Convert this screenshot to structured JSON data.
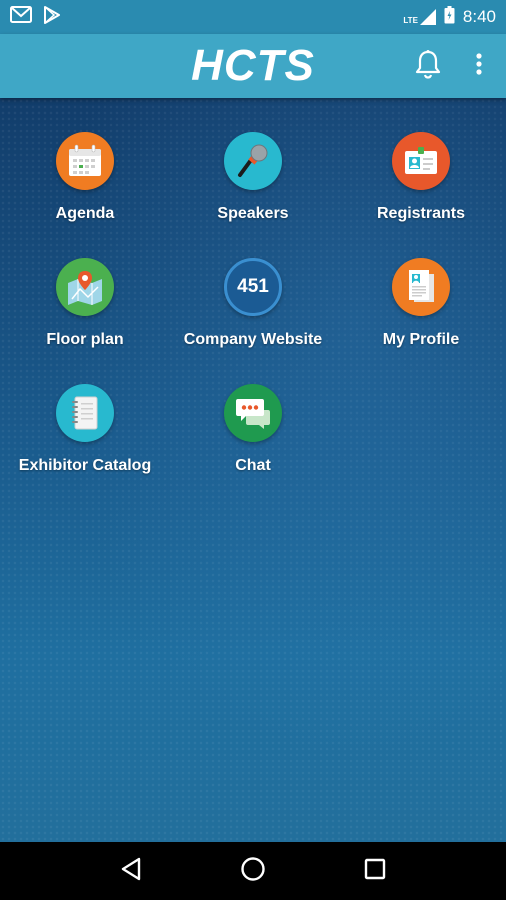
{
  "app": {
    "title": "HCTS"
  },
  "status": {
    "network": "LTE",
    "time": "8:40"
  },
  "tiles": [
    {
      "label": "Agenda",
      "icon": "calendar-icon",
      "color": "#f07c22"
    },
    {
      "label": "Speakers",
      "icon": "microphone-icon",
      "color": "#28b9cf"
    },
    {
      "label": "Registrants",
      "icon": "id-card-icon",
      "color": "#e8582b"
    },
    {
      "label": "Floor plan",
      "icon": "map-pin-icon",
      "color": "#4bb04f"
    },
    {
      "label": "Company Website",
      "icon": "website-icon",
      "badge": "451",
      "color": "#1b5b94"
    },
    {
      "label": "My Profile",
      "icon": "profile-document-icon",
      "color": "#f07c22"
    },
    {
      "label": "Exhibitor Catalog",
      "icon": "notebook-icon",
      "color": "#28b9cf"
    },
    {
      "label": "Chat",
      "icon": "chat-bubbles-icon",
      "color": "#1f9a4f"
    }
  ],
  "colors": {
    "status_bar": "#2a8bb0",
    "app_bar": "#3fa7c6",
    "background": "#123d6b",
    "nav_bar": "#000000"
  }
}
